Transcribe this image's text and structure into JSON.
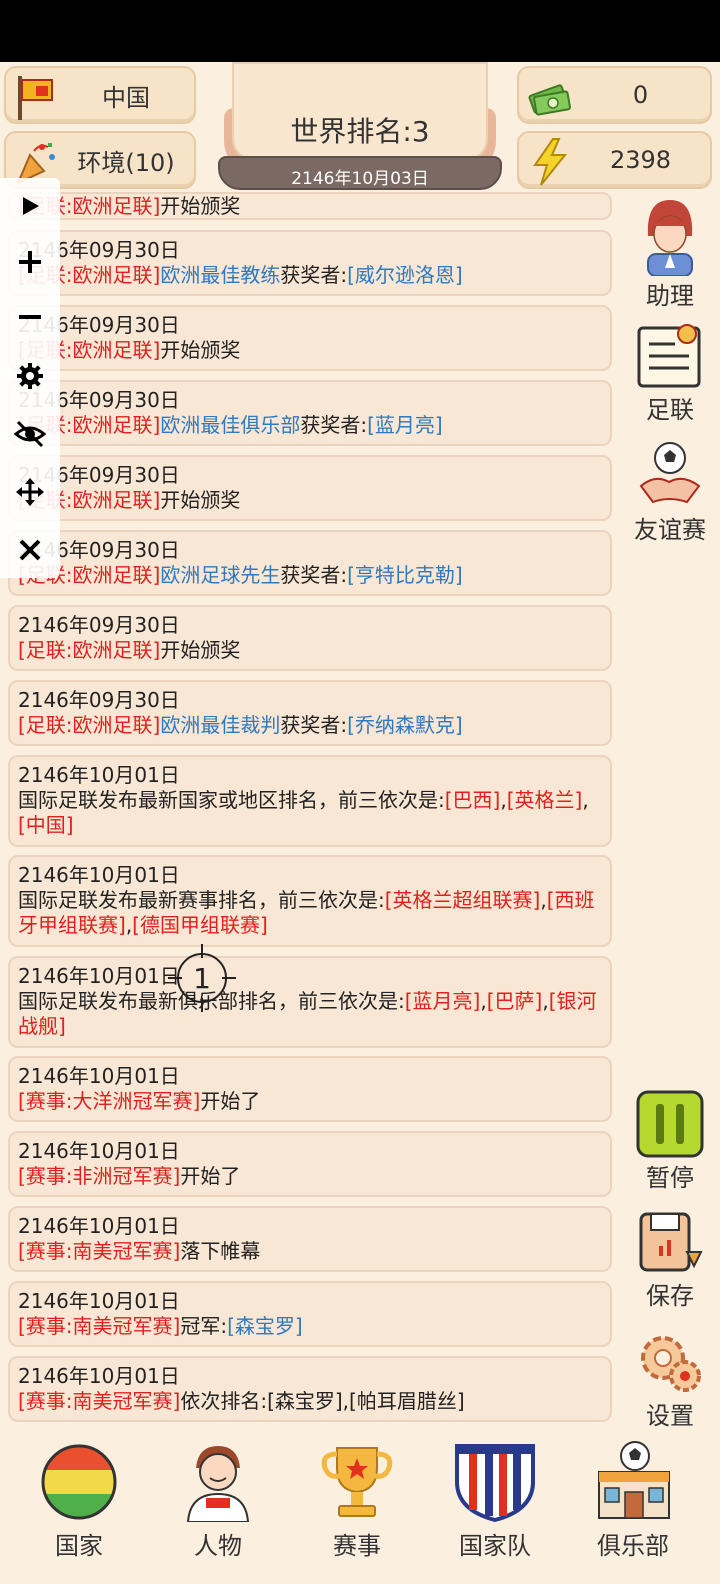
{
  "header": {
    "country": "中国",
    "environment": "环境(10)",
    "money": "0",
    "energy": "2398",
    "rank_title": "世界排名:3",
    "date": "2146年10月03日"
  },
  "logs": [
    {
      "date": "",
      "parts": [
        {
          "t": "[足联:欧洲足联]",
          "c": "red"
        },
        {
          "t": "开始颁奖",
          "c": "dark"
        }
      ]
    },
    {
      "date": "2146年09月30日",
      "parts": [
        {
          "t": "[足联:欧洲足联]",
          "c": "red"
        },
        {
          "t": "欧洲最佳教练",
          "c": "blue"
        },
        {
          "t": "获奖者:",
          "c": "dark"
        },
        {
          "t": "[威尔逊洛恩]",
          "c": "blue"
        }
      ]
    },
    {
      "date": "2146年09月30日",
      "parts": [
        {
          "t": "[足联:欧洲足联]",
          "c": "red"
        },
        {
          "t": "开始颁奖",
          "c": "dark"
        }
      ]
    },
    {
      "date": "2146年09月30日",
      "parts": [
        {
          "t": "[足联:欧洲足联]",
          "c": "red"
        },
        {
          "t": "欧洲最佳俱乐部",
          "c": "blue"
        },
        {
          "t": "获奖者:",
          "c": "dark"
        },
        {
          "t": "[蓝月亮]",
          "c": "blue"
        }
      ]
    },
    {
      "date": "2146年09月30日",
      "parts": [
        {
          "t": "[足联:欧洲足联]",
          "c": "red"
        },
        {
          "t": "开始颁奖",
          "c": "dark"
        }
      ]
    },
    {
      "date": "2146年09月30日",
      "parts": [
        {
          "t": "[足联:欧洲足联]",
          "c": "red"
        },
        {
          "t": "欧洲足球先生",
          "c": "blue"
        },
        {
          "t": "获奖者:",
          "c": "dark"
        },
        {
          "t": "[亨特比克勒]",
          "c": "blue"
        }
      ]
    },
    {
      "date": "2146年09月30日",
      "parts": [
        {
          "t": "[足联:欧洲足联]",
          "c": "red"
        },
        {
          "t": "开始颁奖",
          "c": "dark"
        }
      ]
    },
    {
      "date": "2146年09月30日",
      "parts": [
        {
          "t": "[足联:欧洲足联]",
          "c": "red"
        },
        {
          "t": "欧洲最佳裁判",
          "c": "blue"
        },
        {
          "t": "获奖者:",
          "c": "dark"
        },
        {
          "t": "[乔纳森默克]",
          "c": "blue"
        }
      ]
    },
    {
      "date": "2146年10月01日",
      "parts": [
        {
          "t": "国际足联发布最新国家或地区排名，前三依次是:",
          "c": "dark"
        },
        {
          "t": "[巴西]",
          "c": "red"
        },
        {
          "t": ",",
          "c": "dark"
        },
        {
          "t": "[英格兰]",
          "c": "red"
        },
        {
          "t": ",",
          "c": "dark"
        },
        {
          "t": "[中国]",
          "c": "red"
        }
      ]
    },
    {
      "date": "2146年10月01日",
      "parts": [
        {
          "t": "国际足联发布最新赛事排名，前三依次是:",
          "c": "dark"
        },
        {
          "t": "[英格兰超组联赛]",
          "c": "red"
        },
        {
          "t": ",",
          "c": "dark"
        },
        {
          "t": "[西班牙甲组联赛]",
          "c": "red"
        },
        {
          "t": ",",
          "c": "dark"
        },
        {
          "t": "[德国甲组联赛]",
          "c": "red"
        }
      ]
    },
    {
      "date": "2146年10月01日",
      "parts": [
        {
          "t": "国际足联发布最新俱乐部排名，前三依次是:",
          "c": "dark"
        },
        {
          "t": "[蓝月亮]",
          "c": "red"
        },
        {
          "t": ",",
          "c": "dark"
        },
        {
          "t": "[巴萨]",
          "c": "red"
        },
        {
          "t": ",",
          "c": "dark"
        },
        {
          "t": "[银河战舰]",
          "c": "red"
        }
      ]
    },
    {
      "date": "2146年10月01日",
      "parts": [
        {
          "t": "[赛事:大洋洲冠军赛]",
          "c": "red"
        },
        {
          "t": "开始了",
          "c": "dark"
        }
      ]
    },
    {
      "date": "2146年10月01日",
      "parts": [
        {
          "t": "[赛事:非洲冠军赛]",
          "c": "red"
        },
        {
          "t": "开始了",
          "c": "dark"
        }
      ]
    },
    {
      "date": "2146年10月01日",
      "parts": [
        {
          "t": "[赛事:南美冠军赛]",
          "c": "red"
        },
        {
          "t": "落下帷幕",
          "c": "dark"
        }
      ]
    },
    {
      "date": "2146年10月01日",
      "parts": [
        {
          "t": "[赛事:南美冠军赛]",
          "c": "red"
        },
        {
          "t": "冠军:",
          "c": "dark"
        },
        {
          "t": "[森宝罗]",
          "c": "blue"
        }
      ]
    },
    {
      "date": "2146年10月01日",
      "parts": [
        {
          "t": "[赛事:南美冠军赛]",
          "c": "red"
        },
        {
          "t": "依次排名:[森宝罗],[帕耳眉腊丝]",
          "c": "dark"
        }
      ]
    }
  ],
  "side_menu": {
    "assistant": "助理",
    "federation": "足联",
    "friendly": "友谊赛",
    "pause": "暂停",
    "save": "保存",
    "settings": "设置"
  },
  "bottom_nav": {
    "country": "国家",
    "people": "人物",
    "events": "赛事",
    "national_team": "国家队",
    "club": "俱乐部"
  },
  "crosshair_label": "1",
  "colors": {
    "background": "#fbefe0",
    "red_text": "#e0201e",
    "blue_text": "#2f79c0",
    "pause_green": "#b5d92f"
  }
}
